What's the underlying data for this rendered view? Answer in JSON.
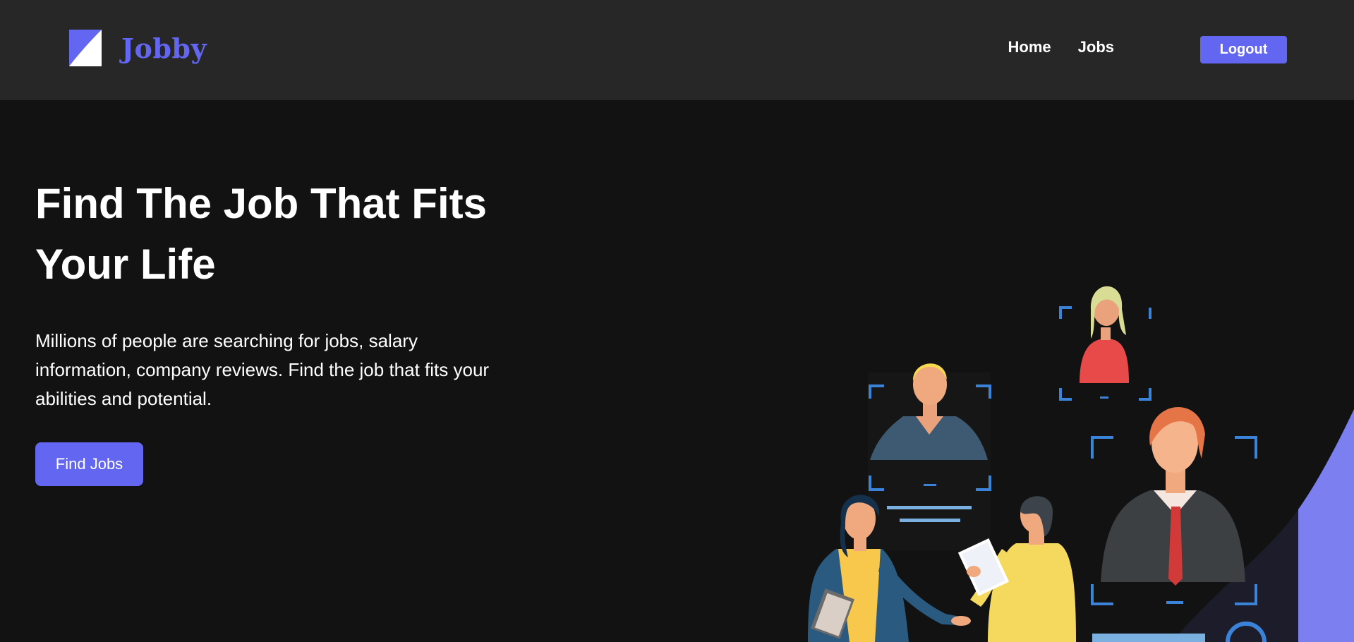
{
  "navbar": {
    "brand": "Jobby",
    "logo_icon": "jobby-logo-icon",
    "links": {
      "home": "Home",
      "jobs": "Jobs"
    },
    "logout_label": "Logout"
  },
  "hero": {
    "title": "Find The Job That Fits Your Life",
    "description": "Millions of people are searching for jobs, salary information, company reviews. Find the job that fits your abilities and potential.",
    "cta_label": "Find Jobs",
    "illustration": "people-hiring-illustration"
  },
  "colors": {
    "accent": "#6366f1",
    "navbar_bg": "#272727",
    "page_bg": "#121212",
    "text": "#ffffff"
  }
}
